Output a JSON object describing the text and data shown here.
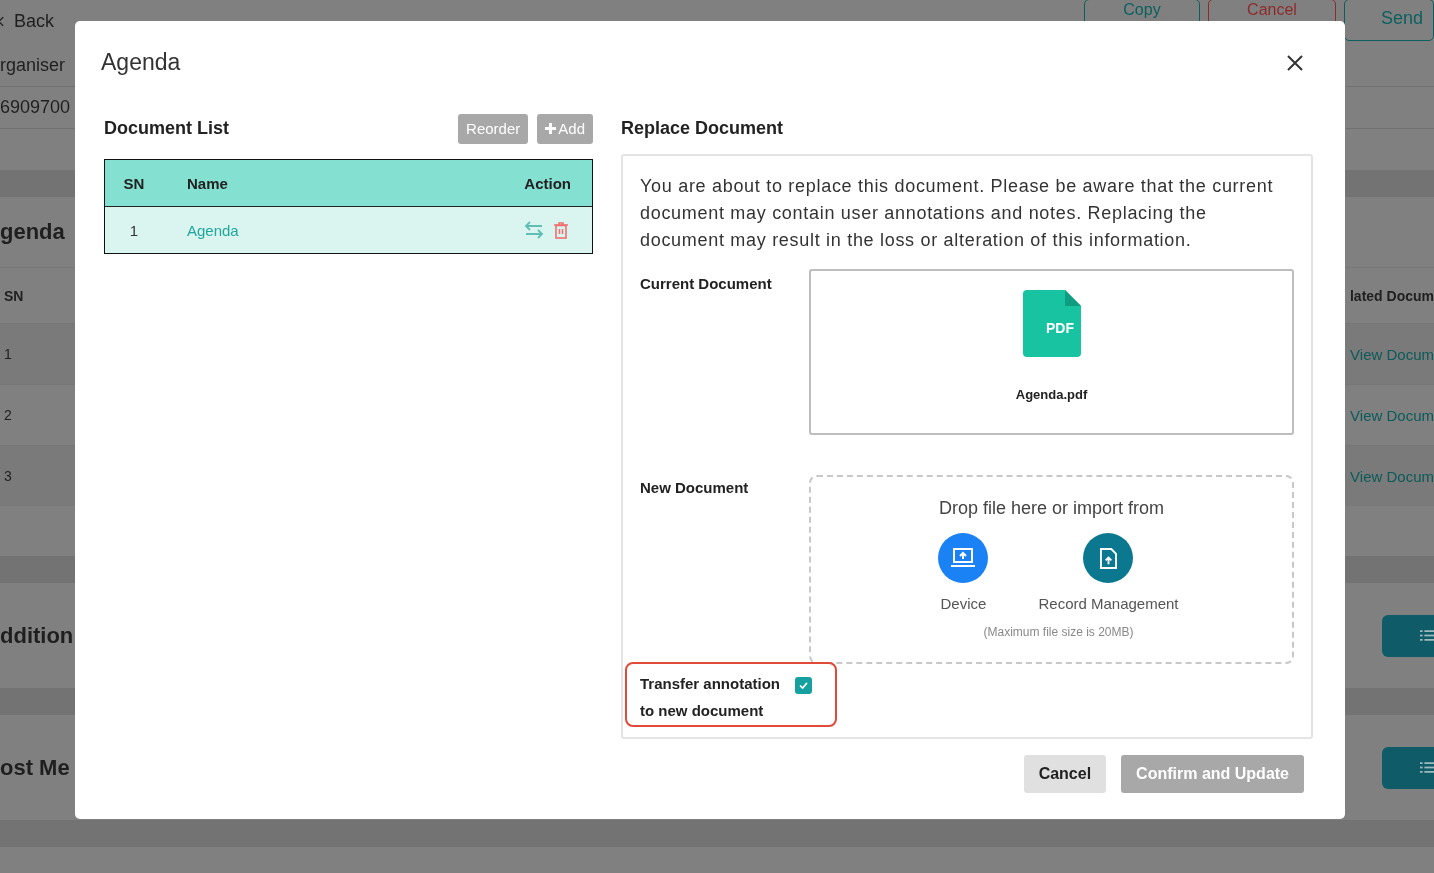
{
  "background": {
    "back": "Back",
    "header_buttons": [
      {
        "label": "Copy",
        "kind": "teal"
      },
      {
        "label": "Cancel",
        "kind": "red"
      },
      {
        "label": "Send",
        "kind": "teal"
      }
    ],
    "fields": [
      "rganiser",
      "6909700"
    ],
    "section_title": "genda",
    "table": {
      "columns": [
        "SN",
        "lated Docum"
      ],
      "rows": [
        {
          "sn": "1",
          "link": "View Docum"
        },
        {
          "sn": "2",
          "link": "View Docum"
        },
        {
          "sn": "3",
          "link": "View Docum"
        }
      ]
    },
    "sections": [
      "ddition",
      "ost Me"
    ]
  },
  "dialog": {
    "title": "Agenda",
    "document_list": {
      "title": "Document List",
      "buttons": [
        {
          "label": "Reorder",
          "kind": "plain",
          "disabled": true
        },
        {
          "label": "Add",
          "kind": "add",
          "disabled": true
        }
      ],
      "columns": [
        "SN",
        "Name",
        "Action"
      ],
      "rows": [
        {
          "sn": "1",
          "name": "Agenda"
        }
      ]
    },
    "replace": {
      "title": "Replace Document",
      "message": "You are about to replace this document. Please be aware that the current document may contain user annotations and notes. Replacing the document may result in the loss or alteration of this information.",
      "current_label": "Current Document",
      "file_badge": "PDF",
      "current_file": "Agenda.pdf",
      "new_label": "New Document",
      "drop_text": "Drop file here or import from",
      "sources": [
        {
          "label": "Device",
          "kind": "device"
        },
        {
          "label": "Record Management",
          "kind": "records"
        }
      ],
      "max_size": "(Maximum file size is 20MB)",
      "transfer": {
        "label": "Transfer annotation to new document",
        "checked": true
      }
    },
    "footer_buttons": [
      {
        "label": "Cancel",
        "disabled": false
      },
      {
        "label": "Confirm and Update",
        "disabled": true
      }
    ]
  }
}
